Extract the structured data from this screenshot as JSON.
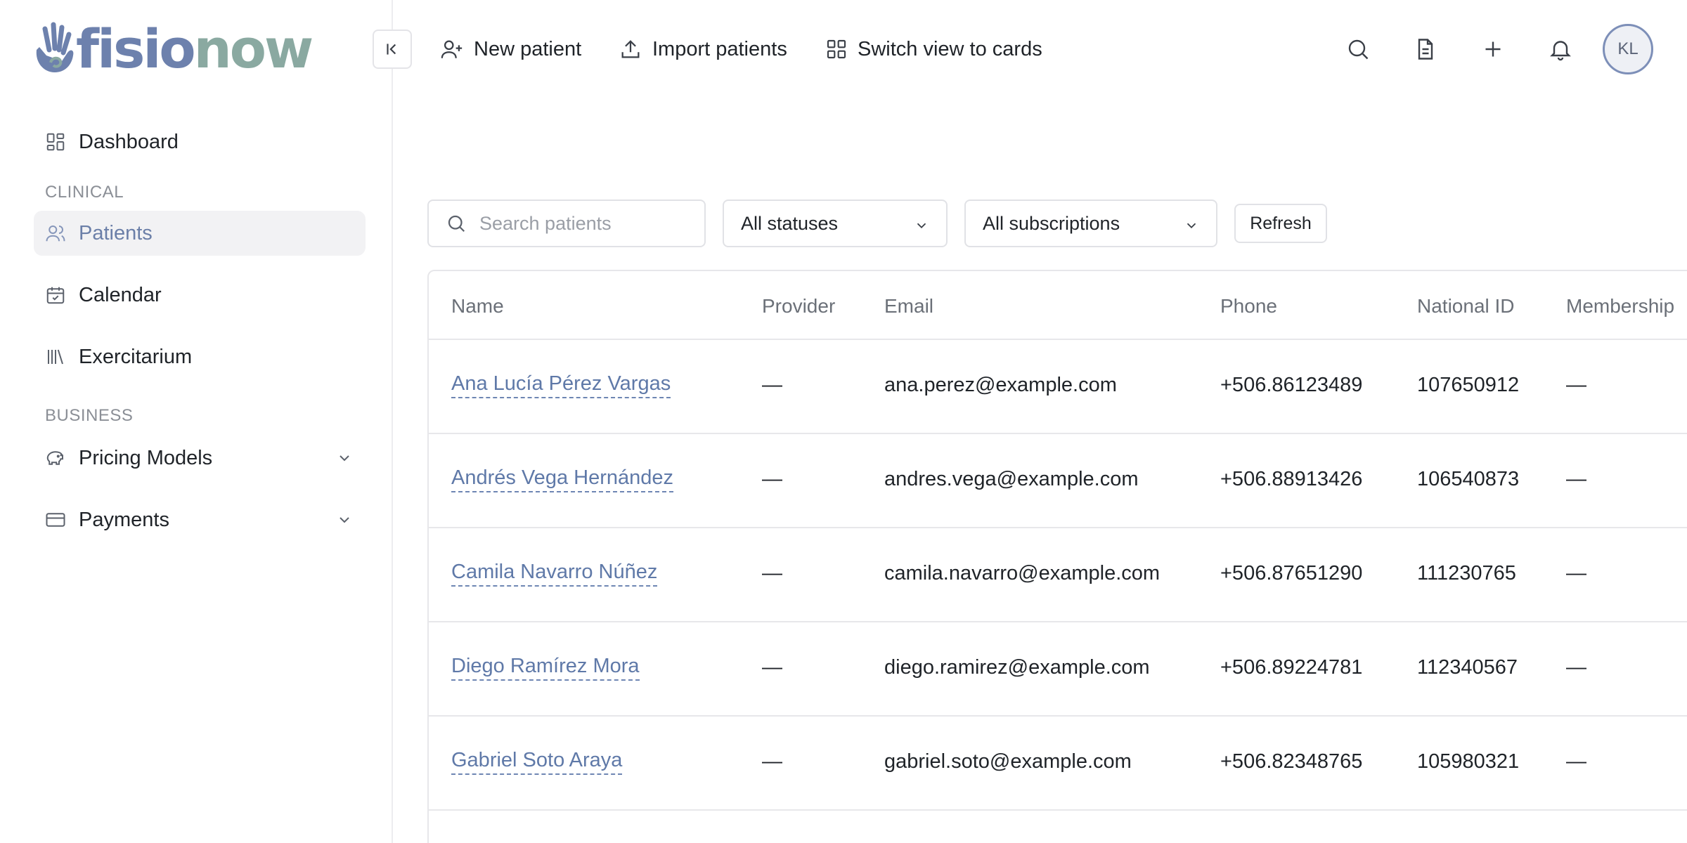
{
  "app": {
    "logo_part1": "fisio",
    "logo_part2": "now"
  },
  "sidebar": {
    "dashboard": "Dashboard",
    "section_clinical": "CLINICAL",
    "patients": "Patients",
    "calendar": "Calendar",
    "exercitarium": "Exercitarium",
    "section_business": "BUSINESS",
    "pricing_models": "Pricing Models",
    "payments": "Payments"
  },
  "toolbar": {
    "new_patient": "New patient",
    "import_patients": "Import patients",
    "switch_view": "Switch view to cards",
    "avatar_initials": "KL"
  },
  "filters": {
    "search_placeholder": "Search patients",
    "status_selected": "All statuses",
    "subscription_selected": "All subscriptions",
    "refresh_label": "Refresh"
  },
  "table": {
    "headers": [
      "Name",
      "Provider",
      "Email",
      "Phone",
      "National ID",
      "Membership"
    ],
    "rows": [
      {
        "name": "Ana Lucía Pérez Vargas",
        "provider": "—",
        "email": "ana.perez@example.com",
        "phone": "+506.86123489",
        "national_id": "107650912",
        "membership": "—"
      },
      {
        "name": "Andrés Vega Hernández",
        "provider": "—",
        "email": "andres.vega@example.com",
        "phone": "+506.88913426",
        "national_id": "106540873",
        "membership": "—"
      },
      {
        "name": "Camila Navarro Núñez",
        "provider": "—",
        "email": "camila.navarro@example.com",
        "phone": "+506.87651290",
        "national_id": "111230765",
        "membership": "—"
      },
      {
        "name": "Diego Ramírez Mora",
        "provider": "—",
        "email": "diego.ramirez@example.com",
        "phone": "+506.89224781",
        "national_id": "112340567",
        "membership": "—"
      },
      {
        "name": "Gabriel Soto Araya",
        "provider": "—",
        "email": "gabriel.soto@example.com",
        "phone": "+506.82348765",
        "national_id": "105980321",
        "membership": "—"
      }
    ]
  },
  "colors": {
    "accent": "#6b7fa8",
    "logo_blue": "#6d81ad",
    "logo_green": "#8aa9a1"
  }
}
